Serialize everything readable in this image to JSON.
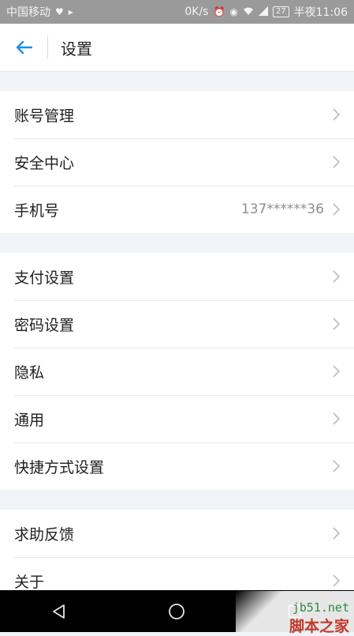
{
  "statusbar": {
    "carrier": "中国移动",
    "speed": "0K/s",
    "battery": "27",
    "time": "半夜11:06",
    "icons": [
      "heart-icon",
      "play-icon",
      "alarm-icon",
      "eye-icon",
      "wifi-icon",
      "signal-icon",
      "battery-icon"
    ]
  },
  "appbar": {
    "title": "设置",
    "back_icon": "arrow-left-icon"
  },
  "groups": [
    {
      "items": [
        {
          "label": "账号管理",
          "value": ""
        },
        {
          "label": "安全中心",
          "value": ""
        },
        {
          "label": "手机号",
          "value": "137******36"
        }
      ]
    },
    {
      "items": [
        {
          "label": "支付设置",
          "value": ""
        },
        {
          "label": "密码设置",
          "value": ""
        },
        {
          "label": "隐私",
          "value": ""
        },
        {
          "label": "通用",
          "value": ""
        },
        {
          "label": "快捷方式设置",
          "value": ""
        }
      ]
    },
    {
      "items": [
        {
          "label": "求助反馈",
          "value": ""
        },
        {
          "label": "关于",
          "value": ""
        }
      ]
    }
  ],
  "navbar": {
    "icons": [
      "back-triangle-icon",
      "home-circle-icon",
      "recents-square-icon"
    ]
  },
  "watermark": {
    "site": "jb51.net",
    "name": "脚本之家"
  },
  "colors": {
    "accent": "#1a8ef0",
    "background": "#f0f3f7",
    "statusbar": "#9a9a9a"
  }
}
